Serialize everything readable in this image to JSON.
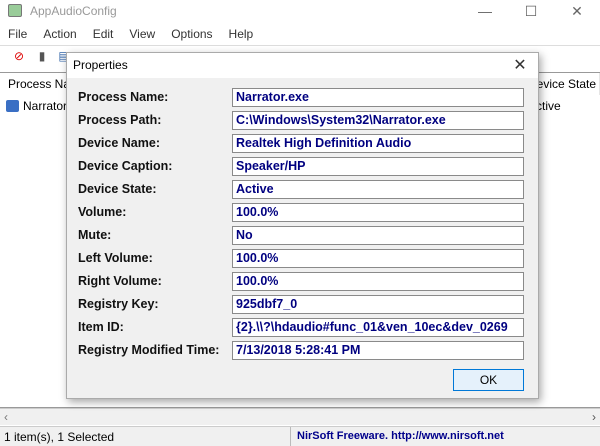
{
  "app": {
    "title": "AppAudioConfig"
  },
  "menu": [
    "File",
    "Action",
    "Edit",
    "View",
    "Options",
    "Help"
  ],
  "list": {
    "columns": [
      "Process Name",
      "Device State"
    ],
    "rows": [
      {
        "process": "Narrator.exe",
        "state": "Active"
      }
    ]
  },
  "dialog": {
    "title": "Properties",
    "fields": [
      {
        "label": "Process Name:",
        "value": "Narrator.exe"
      },
      {
        "label": "Process Path:",
        "value": "C:\\Windows\\System32\\Narrator.exe"
      },
      {
        "label": "Device Name:",
        "value": "Realtek High Definition Audio"
      },
      {
        "label": "Device Caption:",
        "value": "Speaker/HP"
      },
      {
        "label": "Device State:",
        "value": "Active"
      },
      {
        "label": "Volume:",
        "value": "100.0%"
      },
      {
        "label": "Mute:",
        "value": "No"
      },
      {
        "label": "Left Volume:",
        "value": "100.0%"
      },
      {
        "label": "Right Volume:",
        "value": "100.0%"
      },
      {
        "label": "Registry Key:",
        "value": "925dbf7_0"
      },
      {
        "label": "Item ID:",
        "value": "{2}.\\\\?\\hdaudio#func_01&ven_10ec&dev_0269"
      },
      {
        "label": "Registry Modified Time:",
        "value": "7/13/2018 5:28:41 PM"
      }
    ],
    "ok_label": "OK"
  },
  "status": {
    "count": "1 item(s), 1 Selected",
    "credit": "NirSoft Freeware.  http://www.nirsoft.net",
    "credit_color": "#00008b"
  }
}
